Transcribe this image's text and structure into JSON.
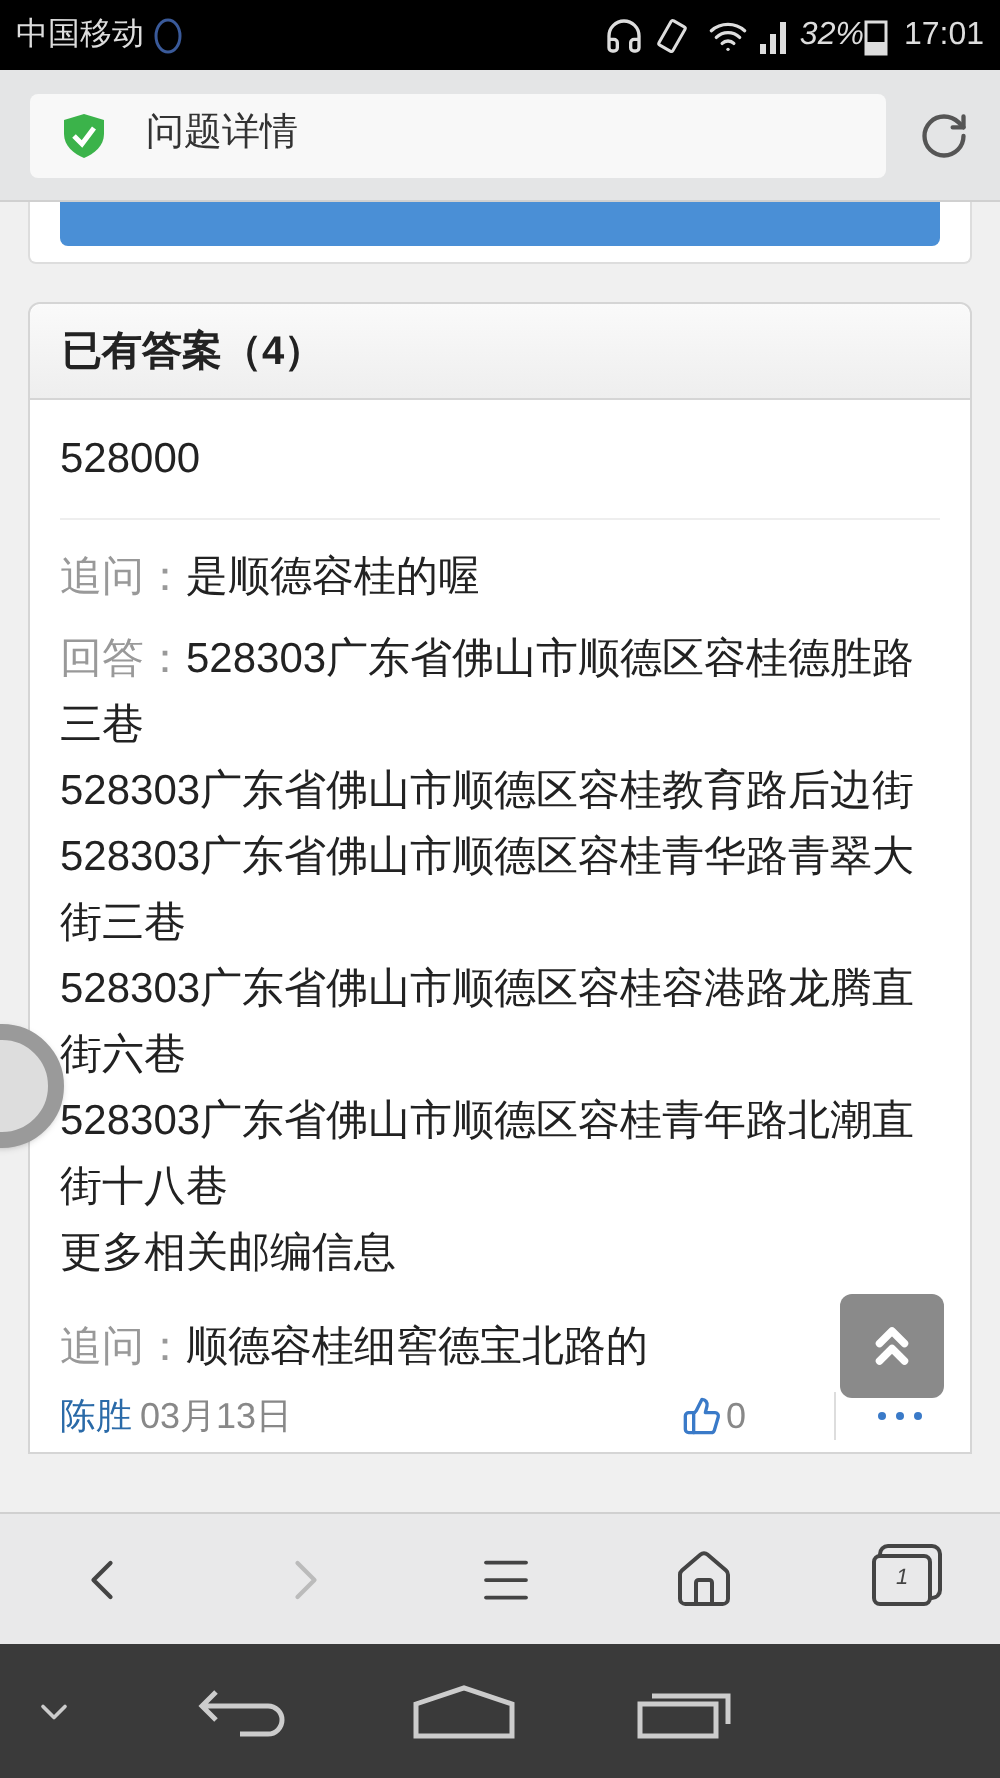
{
  "status_bar": {
    "carrier": "中国移动",
    "battery": "32%",
    "time": "17:01"
  },
  "address_bar": {
    "title": "问题详情"
  },
  "answers_panel": {
    "heading": "已有答案（4）",
    "answer": "528000",
    "thread": [
      {
        "kind": "followup",
        "label": "追问：",
        "lines": [
          "是顺德容桂的喔"
        ]
      },
      {
        "kind": "reply",
        "label": "回答：",
        "lines": [
          "528303广东省佛山市顺德区容桂德胜路三巷",
          "528303广东省佛山市顺德区容桂教育路后边街",
          "528303广东省佛山市顺德区容桂青华路青翠大街三巷",
          "528303广东省佛山市顺德区容桂容港路龙腾直街六巷",
          "528303广东省佛山市顺德区容桂青年路北潮直街十八巷",
          "更多相关邮编信息"
        ]
      },
      {
        "kind": "followup",
        "label": "追问：",
        "lines": [
          "顺德容桂细窖德宝北路的"
        ]
      }
    ],
    "author": "陈胜",
    "date": "03月13日",
    "likes": "0"
  },
  "browser_toolbar": {
    "tab_count": "1"
  }
}
